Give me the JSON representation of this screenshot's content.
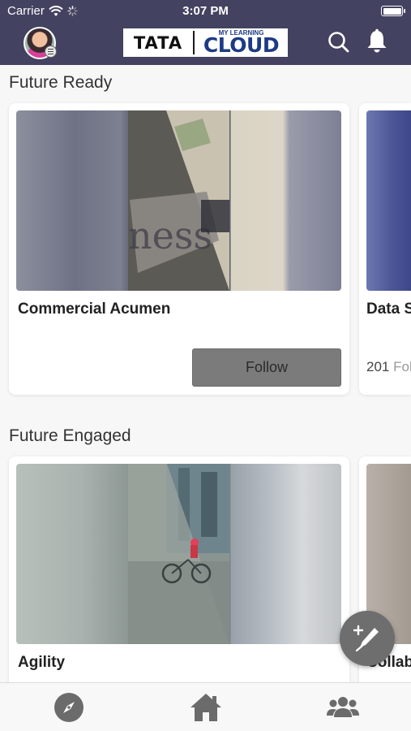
{
  "status_bar": {
    "carrier": "Carrier",
    "time": "3:07 PM"
  },
  "header": {
    "logo_left": "TATA",
    "logo_right_small": "MY LEARNING",
    "logo_right_big": "CLOUD",
    "icons": [
      "avatar",
      "menu-badge-icon",
      "search-icon",
      "bell-icon"
    ]
  },
  "sections": [
    {
      "title": "Future Ready",
      "cards": [
        {
          "title": "Commercial Acumen",
          "button_label": "Follow"
        },
        {
          "title": "Data S",
          "follower_count": "201",
          "follower_label": "Fol"
        }
      ]
    },
    {
      "title": "Future Engaged",
      "cards": [
        {
          "title": "Agility"
        },
        {
          "title": "Collab"
        }
      ]
    }
  ],
  "fab": {
    "icon": "pen-plus-icon"
  },
  "tabbar": {
    "tabs": [
      {
        "icon": "compass-icon"
      },
      {
        "icon": "home-icon"
      },
      {
        "icon": "people-icon"
      }
    ]
  },
  "colors": {
    "header_bg": "#434260",
    "follow_button_bg": "#7b7b7b",
    "fab_bg": "#6e6e6e",
    "tab_icon": "#6b6b6b"
  }
}
